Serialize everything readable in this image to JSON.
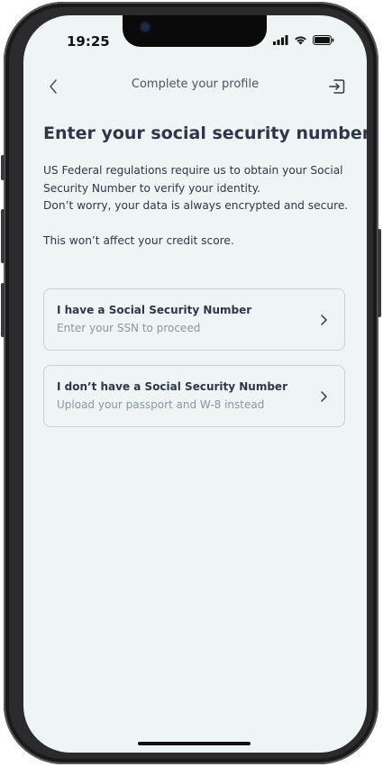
{
  "status_bar": {
    "time": "19:25"
  },
  "nav": {
    "title": "Complete your profile",
    "back_icon": "chevron-left-icon",
    "exit_icon": "exit-icon"
  },
  "content": {
    "heading": "Enter your social security number.",
    "paragraph_1": "US Federal regulations require us to obtain your Social Security Number to verify your identity.",
    "paragraph_2": "Don’t worry, your data is always encrypted and secure.",
    "paragraph_3": "This won’t affect your credit score."
  },
  "options": [
    {
      "title": "I have a Social Security Number",
      "subtitle": "Enter your SSN to proceed"
    },
    {
      "title": "I don’t have a Social Security Number",
      "subtitle": "Upload your passport and W-8 instead"
    }
  ],
  "colors": {
    "screen_bg": "#eff4f4",
    "text_primary": "#2d3748",
    "text_secondary": "#8a96a3",
    "border": "#c8d2d6"
  }
}
